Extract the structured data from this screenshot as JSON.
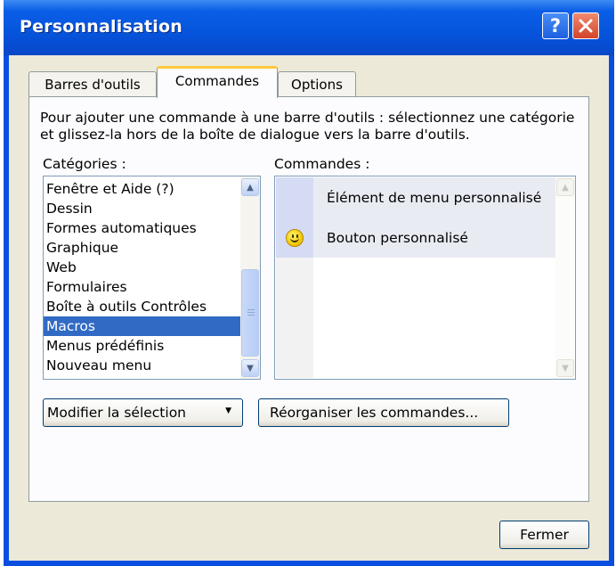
{
  "window": {
    "title": "Personnalisation",
    "help_glyph": "?",
    "close_glyph": "✕",
    "accent": "#0a5ee6"
  },
  "tabs": [
    {
      "label": "Barres d'outils",
      "active": false
    },
    {
      "label": "Commandes",
      "active": true
    },
    {
      "label": "Options",
      "active": false
    }
  ],
  "intro_text": "Pour ajouter une commande à une barre d'outils : sélectionnez une catégorie et glissez-la hors de la boîte de dialogue vers la barre d'outils.",
  "categories": {
    "label": "Catégories :",
    "items": [
      "Fenêtre et Aide (?)",
      "Dessin",
      "Formes automatiques",
      "Graphique",
      "Web",
      "Formulaires",
      "Boîte à outils Contrôles",
      "Macros",
      "Menus prédéfinis",
      "Nouveau menu"
    ],
    "selected": "Macros",
    "selection_color": "#316ac5"
  },
  "commands": {
    "label": "Commandes :",
    "items": [
      {
        "label": "Élément de menu personnalisé",
        "icon": "none"
      },
      {
        "label": "Bouton personnalisé",
        "icon": "smiley-icon"
      }
    ]
  },
  "buttons": {
    "modify_selection": "Modifier la sélection",
    "modify_arrow": "▼",
    "reorganize": "Réorganiser les commandes...",
    "close": "Fermer"
  }
}
